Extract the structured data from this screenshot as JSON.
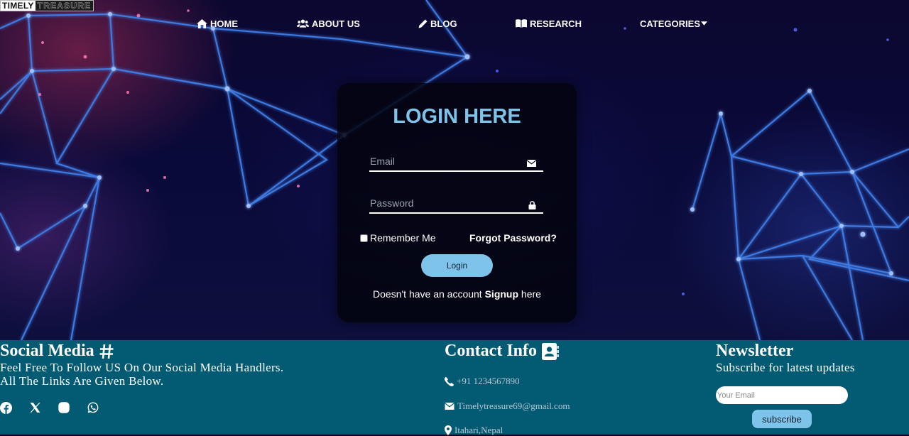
{
  "brand": {
    "part1": "TIMELY",
    "part2": "TREASURE"
  },
  "nav": [
    {
      "label": "HOME",
      "icon": "home-icon"
    },
    {
      "label": "ABOUT US",
      "icon": "users-icon"
    },
    {
      "label": "BLOG",
      "icon": "pencil-icon"
    },
    {
      "label": "RESEARCH",
      "icon": "book-icon"
    },
    {
      "label": "CATEGORIES",
      "icon": "caret-down-icon"
    }
  ],
  "login": {
    "title": "LOGIN HERE",
    "email_placeholder": "Email",
    "email_icon": "envelope-icon",
    "password_placeholder": "Password",
    "password_icon": "lock-icon",
    "remember_label": "Remember Me",
    "forgot_label": "Forgot Password?",
    "button_label": "Login",
    "signup_prefix": "Doesn't have an account ",
    "signup_link": "Signup",
    "signup_suffix": " here"
  },
  "footer": {
    "social": {
      "title": "Social Media",
      "title_icon": "hashtag-icon",
      "line1": "Feel Free To Follow US On Our Social Media Handlers.",
      "line2": "All The Links Are Given Below.",
      "icons": [
        "facebook-icon",
        "x-icon",
        "instagram-icon",
        "whatsapp-icon"
      ]
    },
    "contact": {
      "title": "Contact Info",
      "title_icon": "address-book-icon",
      "phone": "+91 1234567890",
      "email": "Timelytreasure69@gmail.com",
      "location": "Itahari,Nepal"
    },
    "newsletter": {
      "title": "Newsletter",
      "subtitle": "Subscribe for latest updates",
      "input_placeholder": "Your Email",
      "button_label": "subscribe"
    }
  },
  "colors": {
    "accent": "#7ec4ea",
    "footer_bg": "#035b73",
    "hero_bg": "#0a0a3a",
    "network_lines": "#3f7fe8"
  }
}
